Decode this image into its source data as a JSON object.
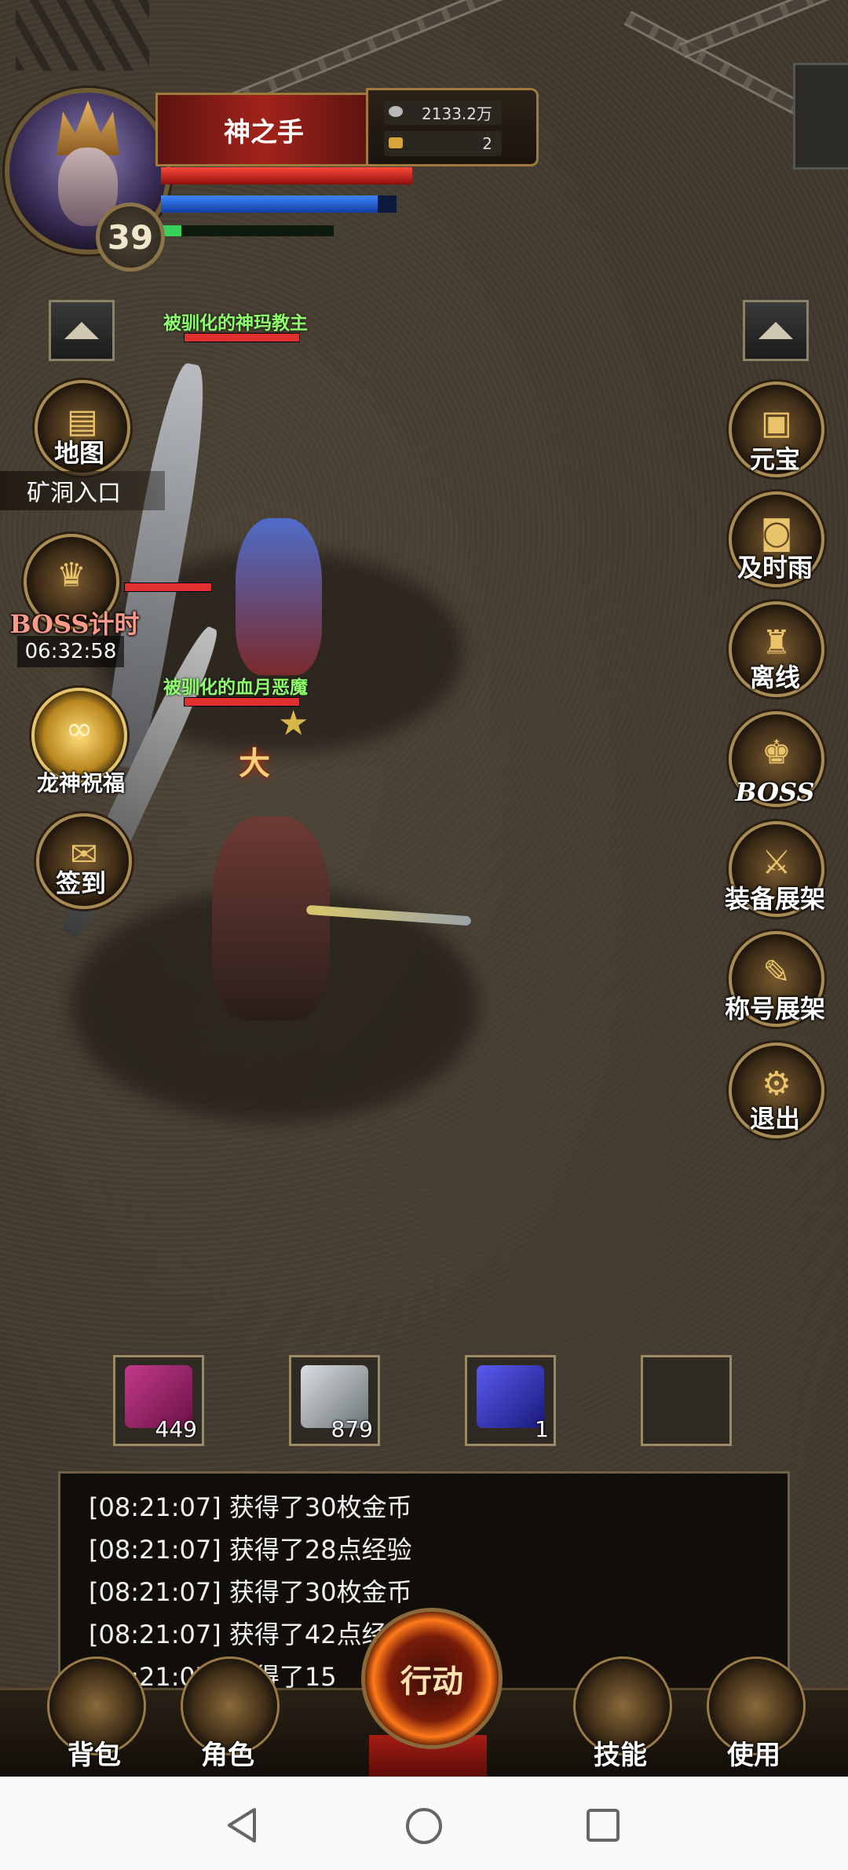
{
  "player": {
    "name": "神之手",
    "level": "39",
    "gold": "2133.2万",
    "ingots": "2",
    "hp_fraction": 1.0,
    "mp_fraction": 0.92,
    "xp_fraction": 0.12
  },
  "map": {
    "location": "矿洞入口",
    "boss_timer": "06:32:58"
  },
  "left_menu": {
    "map": "地图",
    "boss_timer": "BOSS计时",
    "dragon_blessing": "龙神祝福",
    "sign_in": "签到"
  },
  "right_menu": {
    "yuanbao": "元宝",
    "rain": "及时雨",
    "offline": "离线",
    "boss": "BOSS",
    "equip_rack": "装备展架",
    "title_rack": "称号展架",
    "exit": "退出"
  },
  "monsters": [
    {
      "name": "被驯化的神玛教主",
      "hp_fraction": 1.0
    },
    {
      "name": "被驯化的血月恶魔",
      "hp_fraction": 1.0
    }
  ],
  "skill_text": "大",
  "items": [
    {
      "name": "scroll-item",
      "count": "449"
    },
    {
      "name": "silver-item",
      "count": "879"
    },
    {
      "name": "blue-book-item",
      "count": "1"
    },
    {
      "name": "empty-slot",
      "count": ""
    }
  ],
  "log": [
    "[08:21:07] 获得了30枚金币",
    "[08:21:07] 获得了28点经验",
    "[08:21:07] 获得了30枚金币",
    "[08:21:07] 获得了42点经",
    "[08:21:07] 获得了15"
  ],
  "bottom_bar": {
    "bag": "背包",
    "role": "角色",
    "action": "行动",
    "skill": "技能",
    "use": "使用"
  },
  "colors": {
    "hp": "#e03030",
    "mp": "#3f87ff",
    "xp": "#3ad15a",
    "mob_name": "#8cff6a",
    "gold_frame": "#a07a3c"
  },
  "system_nav": [
    "back-icon",
    "home-icon",
    "recents-icon"
  ]
}
